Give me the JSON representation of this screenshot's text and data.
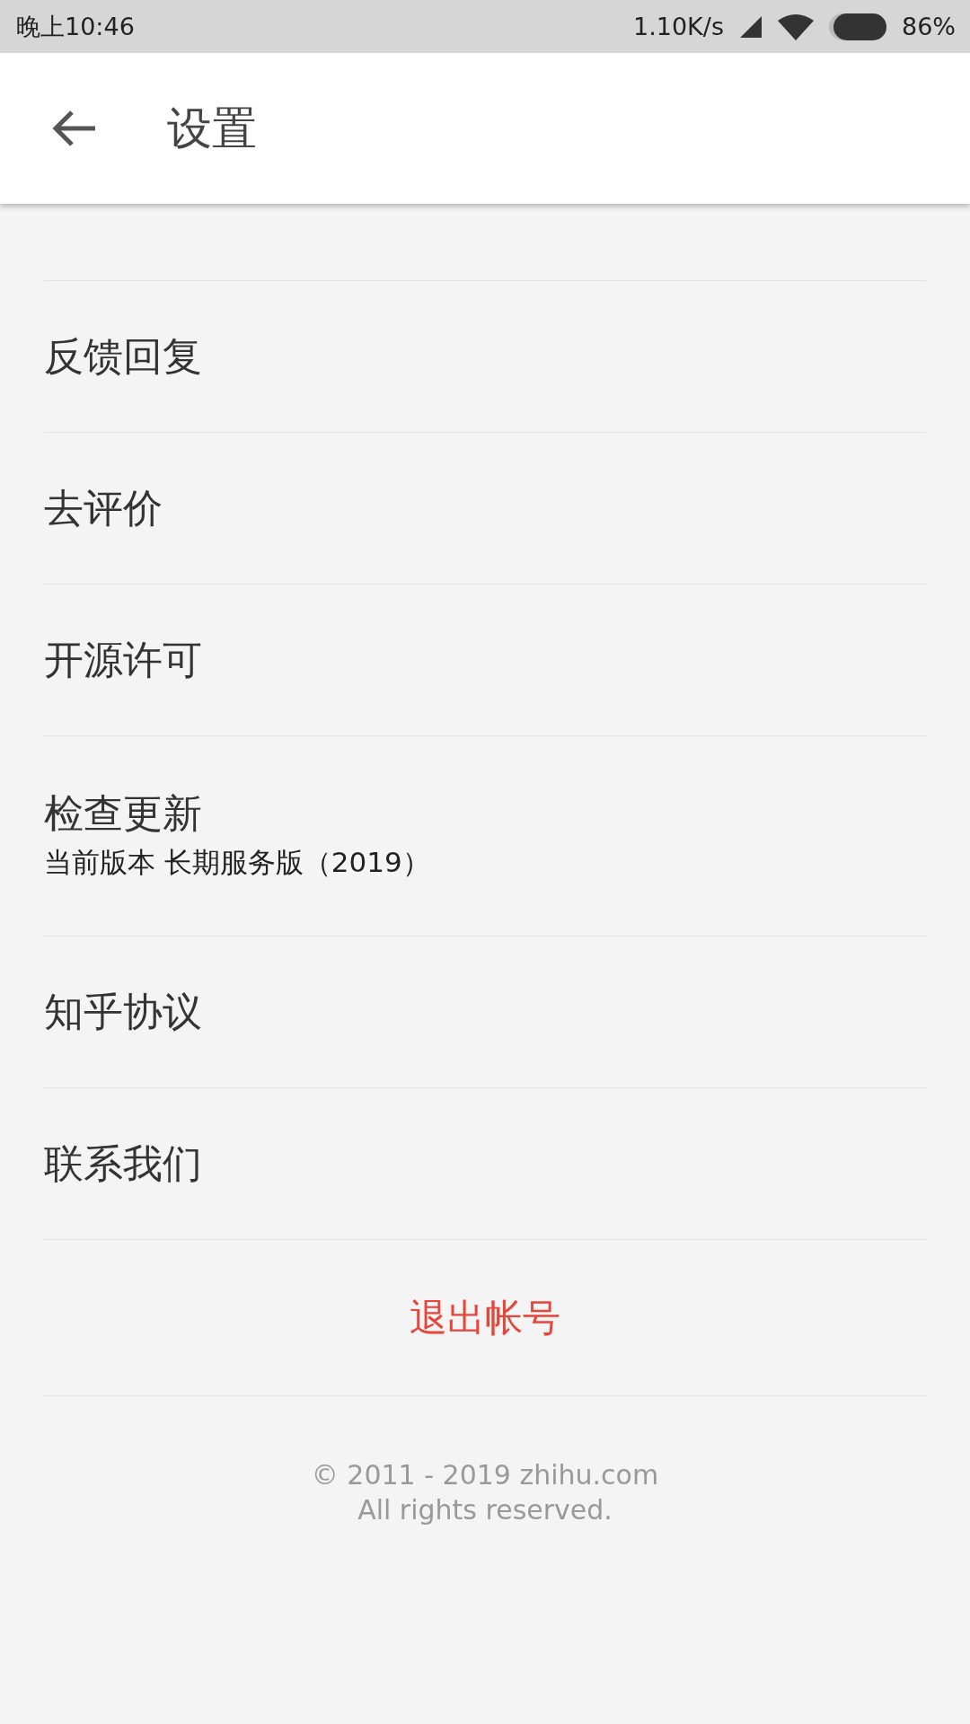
{
  "status_bar": {
    "time": "晚上10:46",
    "speed": "1.10K/s",
    "battery": "86%"
  },
  "app_bar": {
    "title": "设置"
  },
  "items": [
    {
      "label": "反馈回复"
    },
    {
      "label": "去评价"
    },
    {
      "label": "开源许可"
    },
    {
      "label": "检查更新",
      "subtitle": "当前版本 长期服务版（2019）"
    },
    {
      "label": "知乎协议"
    },
    {
      "label": "联系我们"
    }
  ],
  "logout": "退出帐号",
  "footer": [
    "© 2011 - 2019 zhihu.com",
    "All rights reserved."
  ]
}
